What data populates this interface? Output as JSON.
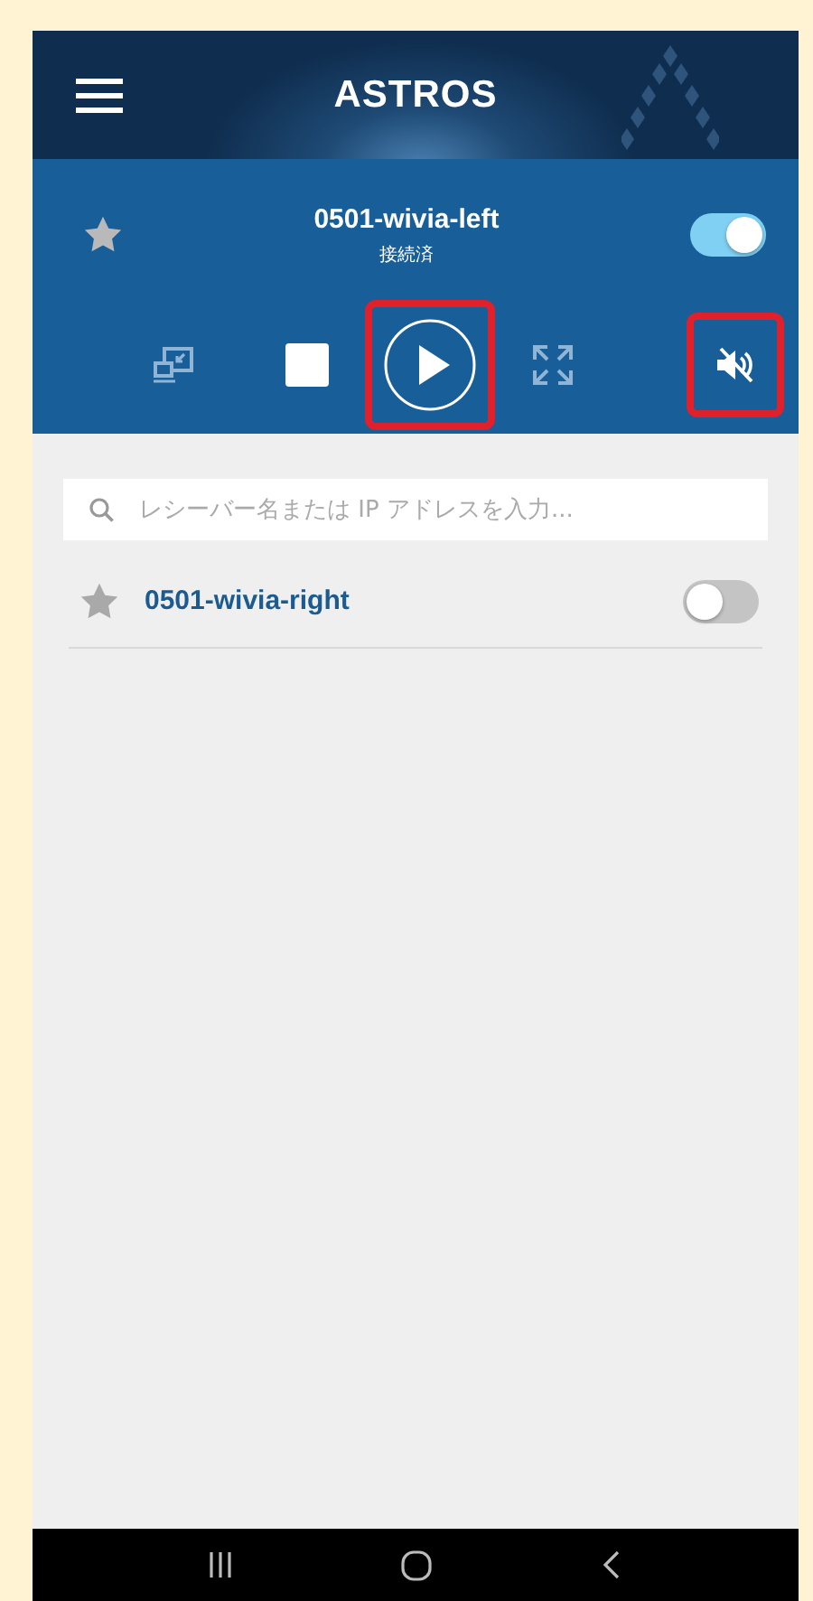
{
  "header": {
    "logo": "ASTROS"
  },
  "current_device": {
    "name": "0501-wivia-left",
    "status": "接続済",
    "on": true
  },
  "controls": [
    {
      "kind": "cast",
      "highlighted": false
    },
    {
      "kind": "stop",
      "highlighted": false
    },
    {
      "kind": "play",
      "highlighted": true
    },
    {
      "kind": "fullscreen",
      "highlighted": false
    },
    {
      "kind": "mute",
      "highlighted": true
    }
  ],
  "search": {
    "placeholder": "レシーバー名または IP アドレスを入力..."
  },
  "receivers": [
    {
      "name": "0501-wivia-right",
      "on": false
    }
  ]
}
